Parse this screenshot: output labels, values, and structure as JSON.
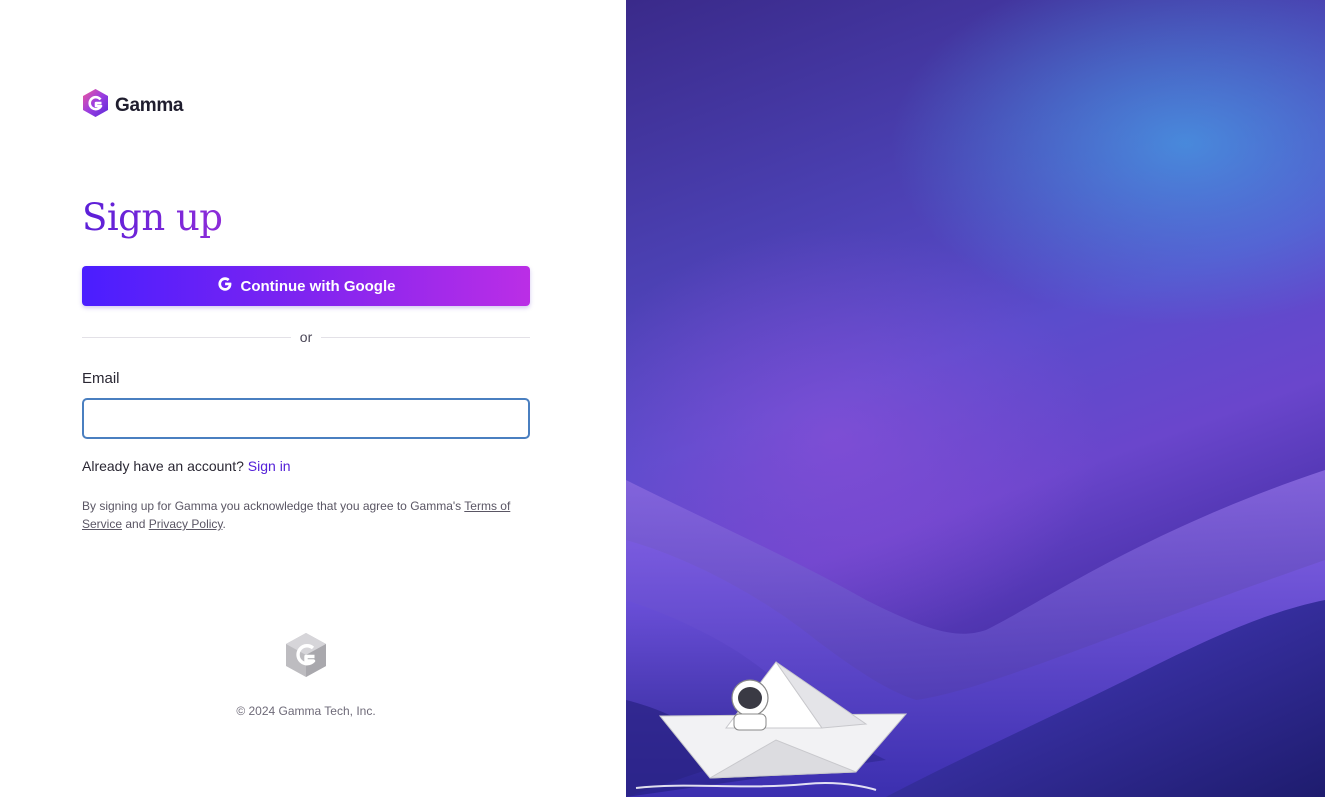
{
  "brand": {
    "name": "Gamma"
  },
  "signup": {
    "title": "Sign up",
    "google_button_label": "Continue with Google",
    "divider_text": "or",
    "email_label": "Email",
    "email_value": "",
    "email_placeholder": ""
  },
  "account": {
    "prompt": "Already have an account?",
    "sign_in_link": "Sign in"
  },
  "legal": {
    "prefix": "By signing up for Gamma you acknowledge that you agree to Gamma's ",
    "terms_link": "Terms of Service",
    "middle": " and ",
    "privacy_link": "Privacy Policy",
    "suffix": "."
  },
  "footer": {
    "copyright": "© 2024 Gamma Tech, Inc."
  },
  "icons": {
    "brand_logo": "gamma-logo-icon",
    "google": "google-icon",
    "footer_logo": "gamma-logo-gray-icon"
  },
  "colors": {
    "accent": "#5420d8",
    "button_gradient_start": "#4a1eff",
    "button_gradient_end": "#bb2ee6",
    "input_focus_border": "#4a7fc0"
  }
}
